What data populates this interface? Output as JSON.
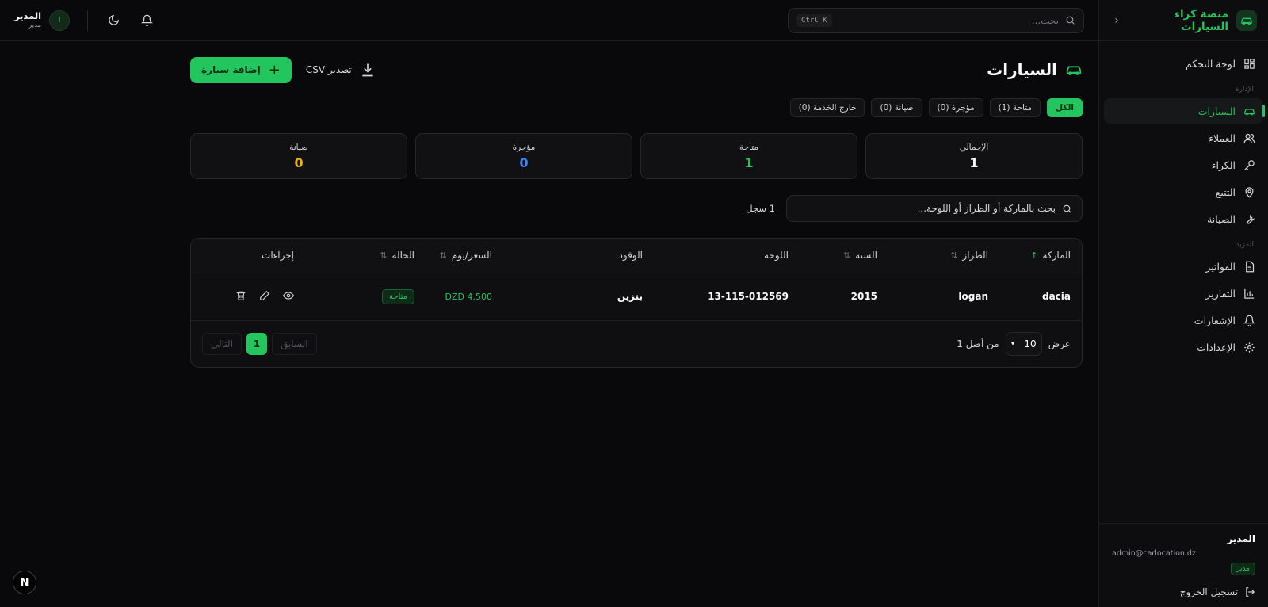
{
  "brand": {
    "title": "منصة كراء السيارات"
  },
  "sidebar": {
    "items": [
      {
        "label": "لوحة التحكم",
        "icon": "dashboard-icon"
      },
      {
        "label": "السيارات",
        "icon": "car-icon"
      },
      {
        "label": "العملاء",
        "icon": "users-icon"
      },
      {
        "label": "الكراء",
        "icon": "key-icon"
      },
      {
        "label": "التتبع",
        "icon": "map-pin-icon"
      },
      {
        "label": "الصيانة",
        "icon": "wrench-icon"
      },
      {
        "label": "الفواتير",
        "icon": "file-icon"
      },
      {
        "label": "التقارير",
        "icon": "bar-chart-icon"
      },
      {
        "label": "الإشعارات",
        "icon": "bell-icon"
      },
      {
        "label": "الإعدادات",
        "icon": "gear-icon"
      }
    ],
    "sections": [
      "الإدارة",
      "المزيد"
    ],
    "active_index": 1
  },
  "footer_user": {
    "name": "المدير",
    "email": "admin@carlocation.dz",
    "role": "مدير",
    "logout": "تسجيل الخروج"
  },
  "topbar": {
    "search_placeholder": "بحث...",
    "shortcut": "Ctrl K",
    "user_name": "المدير",
    "user_role": "مدير",
    "avatar_letter": "I"
  },
  "page": {
    "title": "السيارات",
    "export_label": "تصدير CSV",
    "add_label": "إضافة سيارة"
  },
  "filters": [
    {
      "label": "الكل",
      "active": true
    },
    {
      "label": "متاحة (1)",
      "active": false
    },
    {
      "label": "مؤجرة (0)",
      "active": false
    },
    {
      "label": "صيانة (0)",
      "active": false
    },
    {
      "label": "خارج الخدمة (0)",
      "active": false
    }
  ],
  "stats": [
    {
      "label": "الإجمالي",
      "value": "1",
      "color": "#fafafa"
    },
    {
      "label": "متاحة",
      "value": "1",
      "color": "#22c55e"
    },
    {
      "label": "مؤجرة",
      "value": "0",
      "color": "#3b82f6"
    },
    {
      "label": "صيانة",
      "value": "0",
      "color": "#eab308"
    }
  ],
  "table_search": {
    "placeholder": "بحث بالماركة أو الطراز أو اللوحة...",
    "count": "1 سجل"
  },
  "table": {
    "headers": [
      "الماركة",
      "الطراز",
      "السنة",
      "اللوحة",
      "الوقود",
      "السعر/يوم",
      "الحالة",
      "إجراءات"
    ],
    "rows": [
      {
        "brand": "dacia",
        "model": "logan",
        "year": "2015",
        "plate": "13-115-012569",
        "fuel": "بنزين",
        "price": "DZD 4.500",
        "status": "متاحة"
      }
    ]
  },
  "pagination": {
    "show_label": "عرض",
    "page_size": "10",
    "of_label": "من أصل 1",
    "prev": "السابق",
    "current": "1",
    "next": "التالي"
  },
  "colors": {
    "accent": "#22c55e",
    "background": "#09090b"
  }
}
